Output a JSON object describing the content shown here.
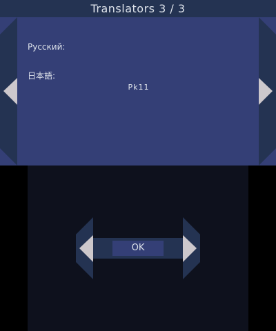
{
  "header": {
    "title": "Translators 3 / 3"
  },
  "credits": [
    {
      "language": "Русский:",
      "names": ""
    },
    {
      "language": "日本語:",
      "names": "Pk11"
    }
  ],
  "dialog": {
    "ok_label": "OK"
  },
  "colors": {
    "panel": "#343f76",
    "frame": "#243352",
    "arrow": "#cdc8cc",
    "bottom_bg": "#0e111d"
  }
}
